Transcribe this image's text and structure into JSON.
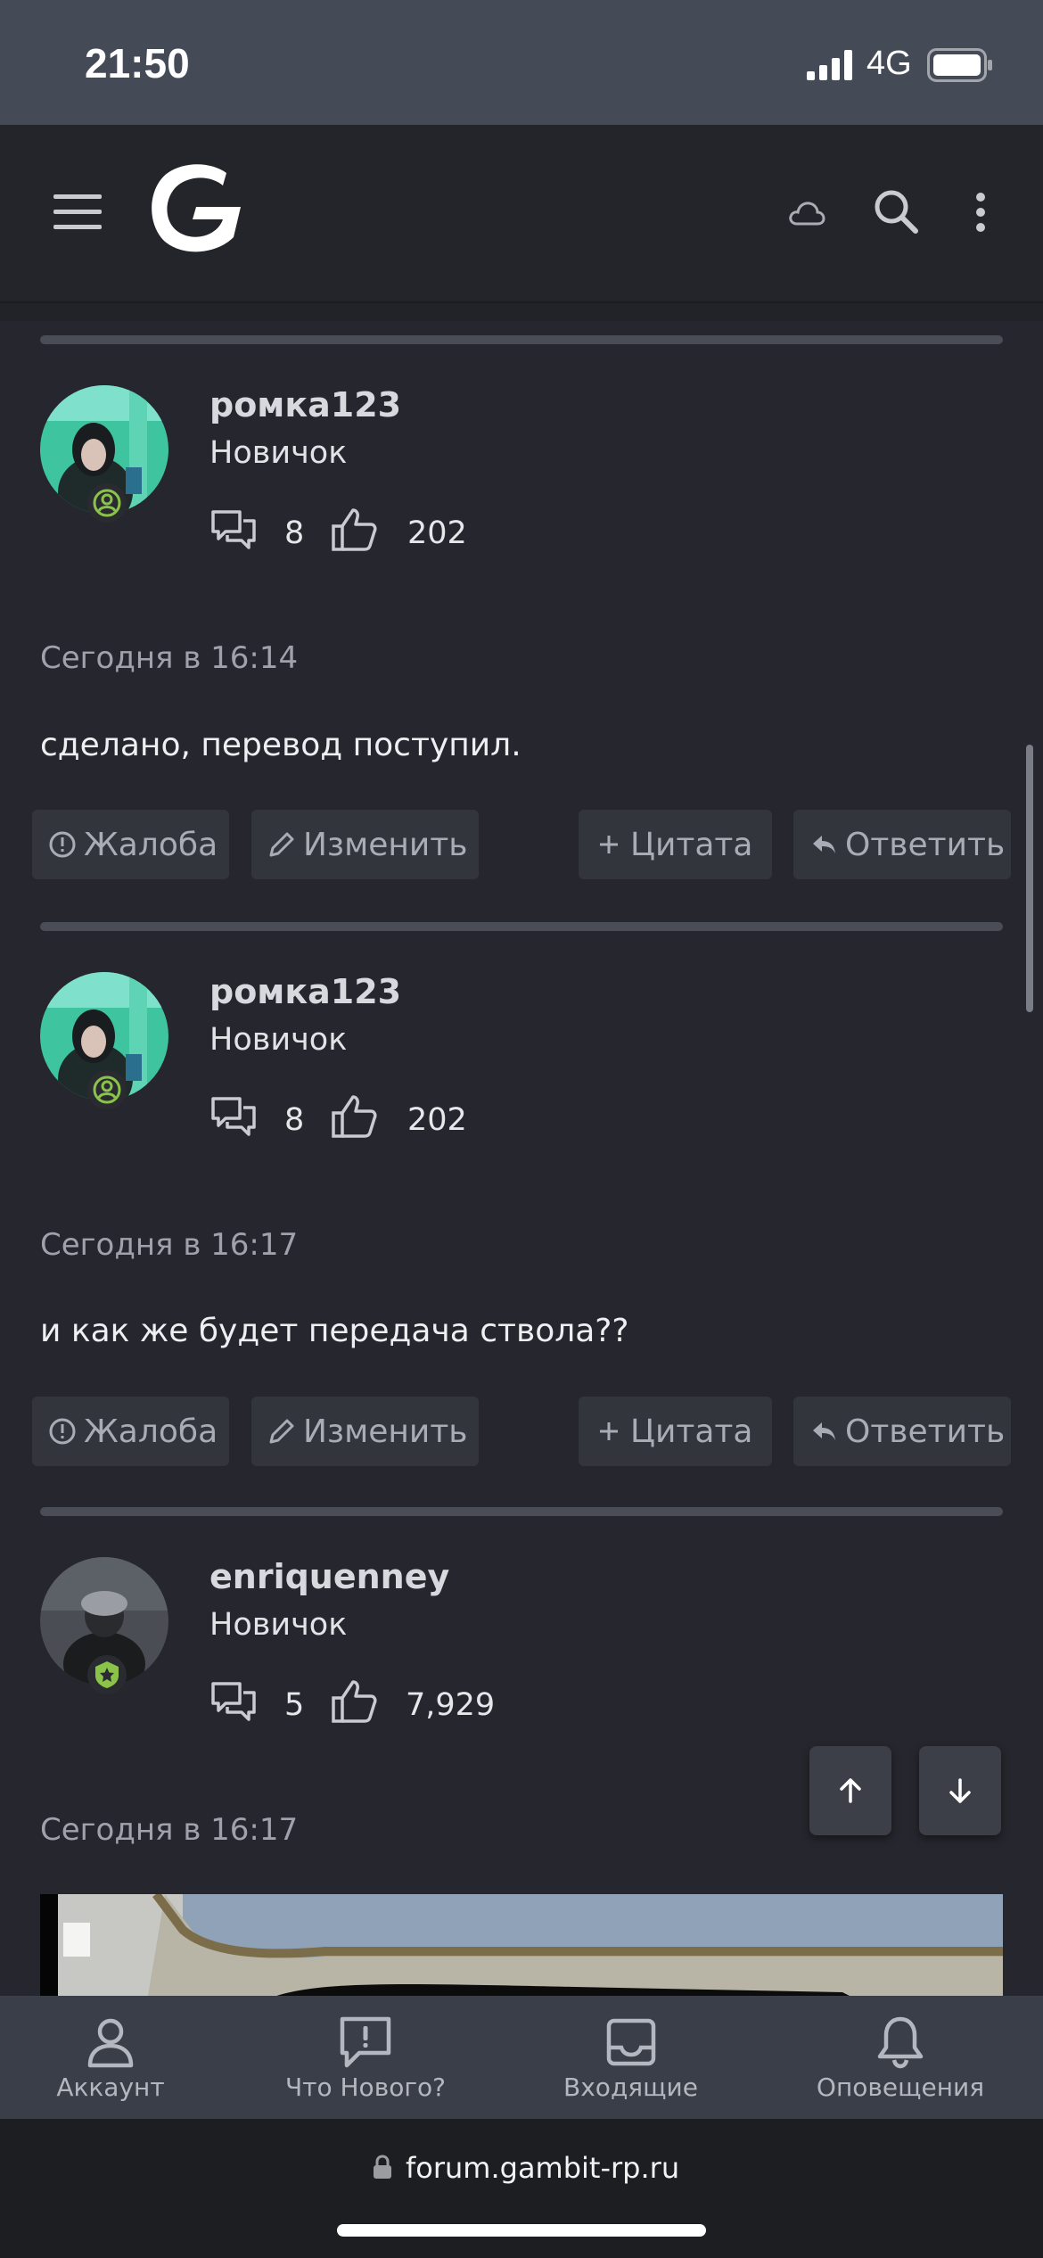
{
  "status_bar": {
    "time": "21:50",
    "network": "4G"
  },
  "header": {
    "logo_letter": "G",
    "icons": [
      "menu-icon",
      "cloud-icon",
      "search-icon",
      "more-vertical-icon"
    ]
  },
  "posts": [
    {
      "username": "ромка123",
      "user_title": "Новичок",
      "messages": "8",
      "reactions": "202",
      "date": "Сегодня в 16:14",
      "body": "сделано, перевод поступил.",
      "actions": {
        "report": "Жалоба",
        "edit": "Изменить",
        "quote": "Цитата",
        "reply": "Ответить"
      }
    },
    {
      "username": "ромка123",
      "user_title": "Новичок",
      "messages": "8",
      "reactions": "202",
      "date": "Сегодня в 16:17",
      "body": "и как же будет передача ствола??",
      "actions": {
        "report": "Жалоба",
        "edit": "Изменить",
        "quote": "Цитата",
        "reply": "Ответить"
      }
    },
    {
      "username": "enriquenney",
      "user_title": "Новичок",
      "messages": "5",
      "reactions": "7,929",
      "date": "Сегодня в 16:17"
    }
  ],
  "bottom_nav": {
    "account": "Аккаунт",
    "whats_new": "Что Нового?",
    "inbox": "Входящие",
    "alerts": "Оповещения"
  },
  "browser": {
    "url": "forum.gambit-rp.ru"
  },
  "colors": {
    "accent_badge": "#8bc34a",
    "background": "#222329"
  }
}
